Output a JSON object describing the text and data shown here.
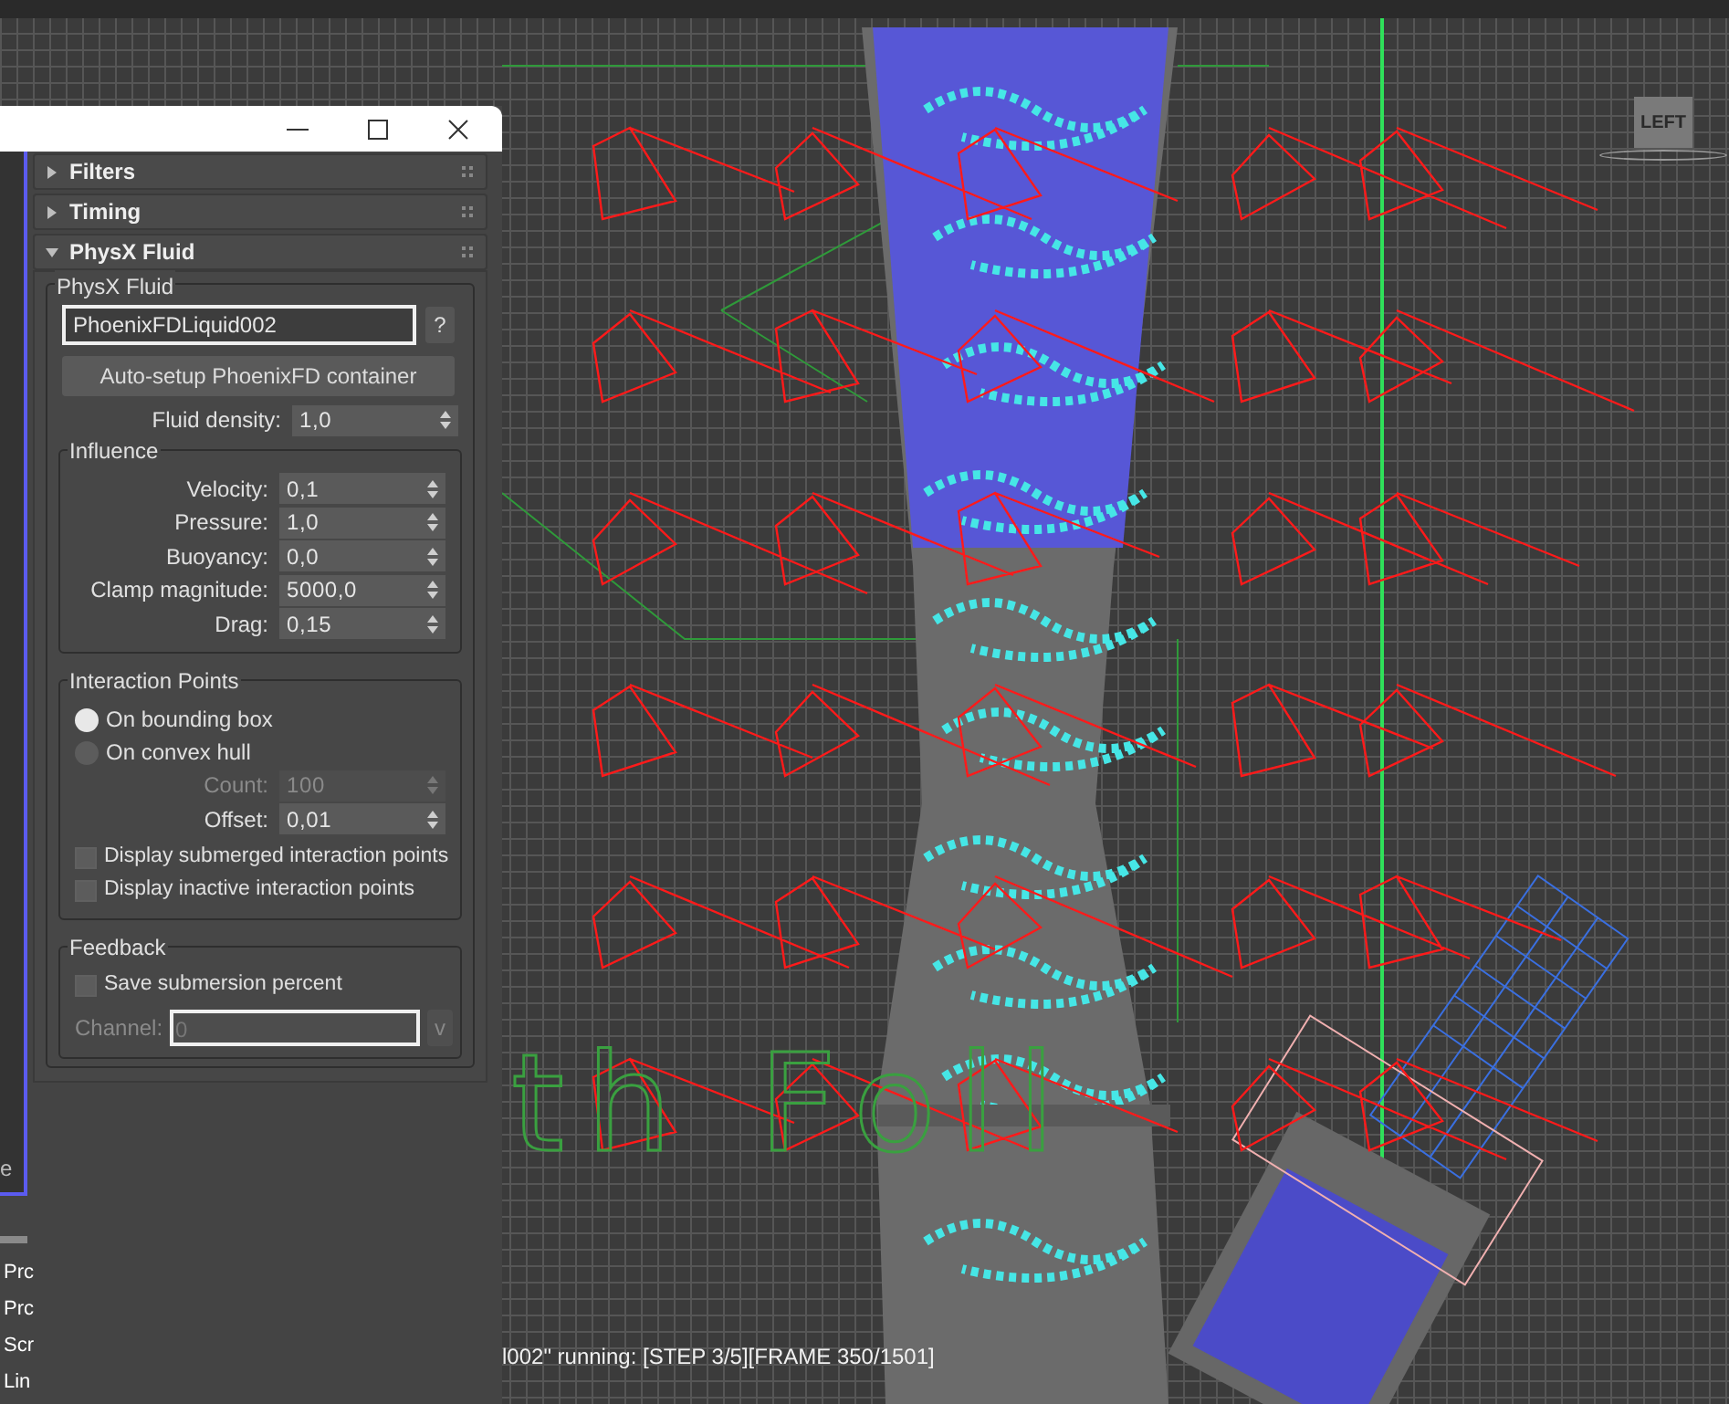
{
  "rollouts": [
    {
      "title": "Filters",
      "expanded": false
    },
    {
      "title": "Timing",
      "expanded": false
    },
    {
      "title": "PhysX Fluid",
      "expanded": true
    }
  ],
  "physx_fluid": {
    "group_title": "PhysX Fluid",
    "node_field": {
      "value": "PhoenixFDLiquid002"
    },
    "help_button": "?",
    "auto_setup_button": "Auto-setup PhoenixFD container",
    "fluid_density": {
      "label": "Fluid density:",
      "value": "1,0"
    }
  },
  "influence": {
    "title": "Influence",
    "params": [
      {
        "label": "Velocity:",
        "value": "0,1"
      },
      {
        "label": "Pressure:",
        "value": "1,0"
      },
      {
        "label": "Buoyancy:",
        "value": "0,0"
      },
      {
        "label": "Clamp magnitude:",
        "value": "5000,0"
      },
      {
        "label": "Drag:",
        "value": "0,15"
      }
    ]
  },
  "interaction_points": {
    "title": "Interaction Points",
    "options": [
      {
        "label": "On bounding box",
        "selected": true
      },
      {
        "label": "On convex hull",
        "selected": false
      }
    ],
    "params": [
      {
        "label": "Count:",
        "value": "100",
        "disabled": true
      },
      {
        "label": "Offset:",
        "value": "0,01",
        "disabled": false
      }
    ],
    "checkboxes": [
      {
        "label": "Display submerged interaction points",
        "checked": false
      },
      {
        "label": "Display inactive interaction points",
        "checked": false
      }
    ]
  },
  "feedback": {
    "title": "Feedback",
    "checkboxes": [
      {
        "label": "Save submersion percent",
        "checked": false
      }
    ],
    "channel": {
      "label": "Channel:",
      "value": "0",
      "disabled": true
    },
    "channel_button": "v"
  },
  "background_panel": {
    "box_text": "e",
    "list": [
      "Prc",
      "Prc",
      "Scr",
      "Lin"
    ]
  },
  "viewport": {
    "view_cube_label": "LEFT",
    "scene_text": "th Foll",
    "status": "l002\" running: [STEP 3/5][FRAME 350/1501]"
  }
}
